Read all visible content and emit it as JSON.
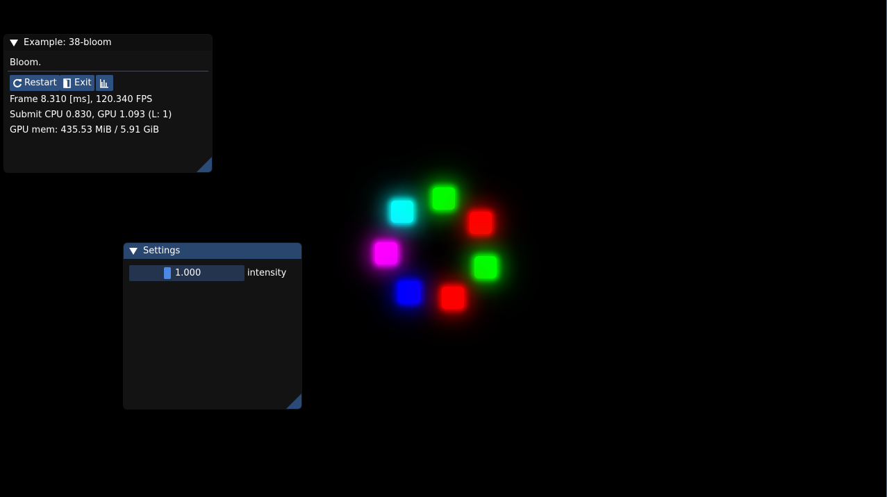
{
  "example_window": {
    "title": "Example: 38-bloom",
    "description": "Bloom.",
    "buttons": {
      "restart": "Restart",
      "exit": "Exit"
    },
    "stats": {
      "frame": "Frame 8.310 [ms], 120.340 FPS",
      "submit": "Submit CPU 0.830, GPU 1.093 (L: 1)",
      "gpu_mem": "GPU mem: 435.53 MiB / 5.91 GiB"
    }
  },
  "settings_window": {
    "title": "Settings",
    "intensity": {
      "label": "intensity",
      "value": "1.000",
      "fraction": 0.32
    }
  },
  "scene": {
    "cubes": [
      {
        "color": "#00ffff"
      },
      {
        "color": "#00ff00"
      },
      {
        "color": "#ff0000"
      },
      {
        "color": "#ff00ff"
      },
      {
        "color": "#00ff00"
      },
      {
        "color": "#0000ff"
      },
      {
        "color": "#ff0000"
      }
    ]
  },
  "colors": {
    "panel_bg": "#141414",
    "title_active": "#29466f",
    "button": "#2f5182",
    "slider_track": "#24344f",
    "slider_grab": "#4a8ae6"
  }
}
